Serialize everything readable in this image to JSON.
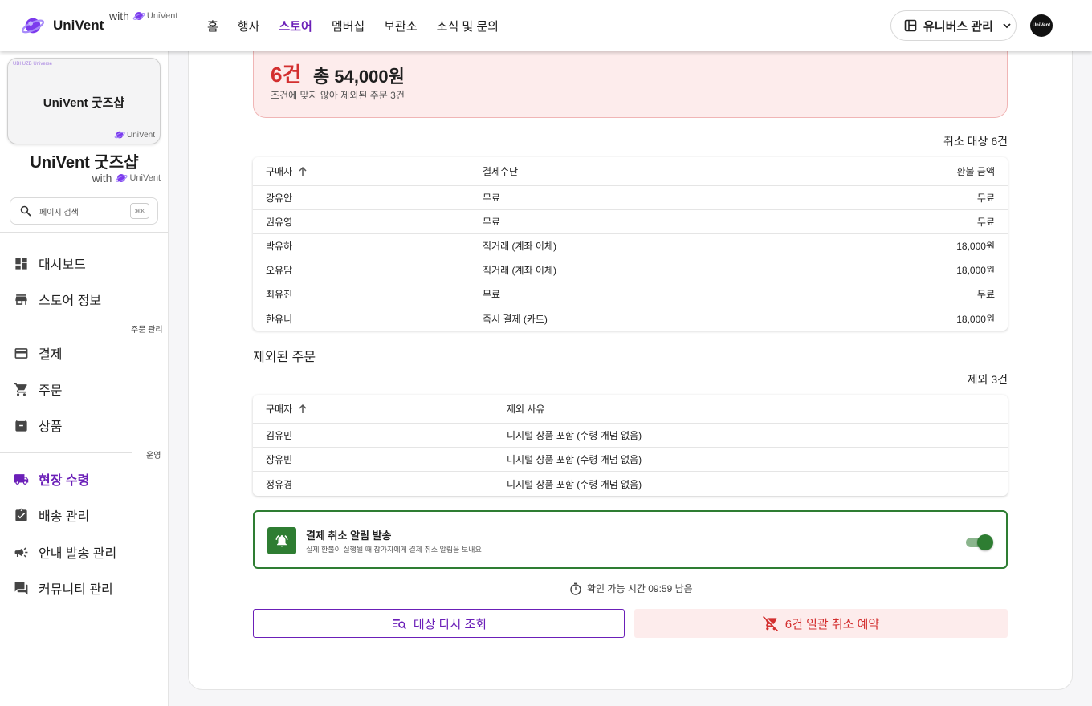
{
  "brand": {
    "name": "UniVent",
    "with": "with",
    "mini": "UniVent"
  },
  "nav": [
    {
      "label": "홈"
    },
    {
      "label": "행사"
    },
    {
      "label": "스토어",
      "active": true
    },
    {
      "label": "멤버십"
    },
    {
      "label": "보관소"
    },
    {
      "label": "소식 및 문의"
    }
  ],
  "universe_button": "유니버스 관리",
  "avatar_text": "UniVent",
  "sidebar": {
    "card_tiny": "UBI UZB Universe",
    "card_title": "UniVent 굿즈샵",
    "card_logo": "UniVent",
    "store_name": "UniVent 굿즈샵",
    "with": "with",
    "with_mini": "UniVent",
    "search_placeholder": "페이지 검색",
    "search_kbd": "⌘K",
    "section_orders": "주문 관리",
    "section_ops": "운영",
    "items": [
      {
        "label": "대시보드",
        "icon": "dashboard-icon"
      },
      {
        "label": "스토어 정보",
        "icon": "store-icon"
      },
      {
        "label": "결제",
        "icon": "credit-card-icon"
      },
      {
        "label": "주문",
        "icon": "cart-icon"
      },
      {
        "label": "상품",
        "icon": "archive-icon"
      },
      {
        "label": "현장 수령",
        "icon": "truck-icon",
        "active": true
      },
      {
        "label": "배송 관리",
        "icon": "clipboard-check-icon"
      },
      {
        "label": "안내 발송 관리",
        "icon": "megaphone-icon"
      },
      {
        "label": "커뮤니티 관리",
        "icon": "forum-icon"
      }
    ]
  },
  "summary": {
    "count": "6건",
    "total": "총 54,000원",
    "note": "조건에 맞지 않아 제외된 주문 3건"
  },
  "targets": {
    "caption": "취소 대상 6건",
    "headers": {
      "buyer": "구매자",
      "method": "결제수단",
      "amount": "환불 금액"
    },
    "rows": [
      {
        "buyer": "강유안",
        "method": "무료",
        "amount": "무료"
      },
      {
        "buyer": "권유영",
        "method": "무료",
        "amount": "무료"
      },
      {
        "buyer": "박유하",
        "method": "직거래 (계좌 이체)",
        "amount": "18,000원"
      },
      {
        "buyer": "오유담",
        "method": "직거래 (계좌 이체)",
        "amount": "18,000원"
      },
      {
        "buyer": "최유진",
        "method": "무료",
        "amount": "무료"
      },
      {
        "buyer": "한유니",
        "method": "즉시 결제 (카드)",
        "amount": "18,000원"
      }
    ]
  },
  "excluded": {
    "title": "제외된 주문",
    "caption": "제외 3건",
    "headers": {
      "buyer": "구매자",
      "reason": "제외 사유"
    },
    "rows": [
      {
        "buyer": "김유민",
        "reason": "디지털 상품 포함 (수령 개념 없음)"
      },
      {
        "buyer": "장유빈",
        "reason": "디지털 상품 포함 (수령 개념 없음)"
      },
      {
        "buyer": "정유경",
        "reason": "디지털 상품 포함 (수령 개념 없음)"
      }
    ]
  },
  "notify": {
    "title": "결제 취소 알림 발송",
    "desc": "실제 환불이 실행될 때 참가자에게 결제 취소 알림을 보내요",
    "enabled": true
  },
  "timer": "확인 가능 시간 09:59 남음",
  "buttons": {
    "requery": "대상 다시 조회",
    "cancel": "6건 일괄 취소 예약"
  },
  "colors": {
    "accent": "#6b1fb8",
    "danger": "#d32f2f",
    "success": "#2e7d32"
  }
}
